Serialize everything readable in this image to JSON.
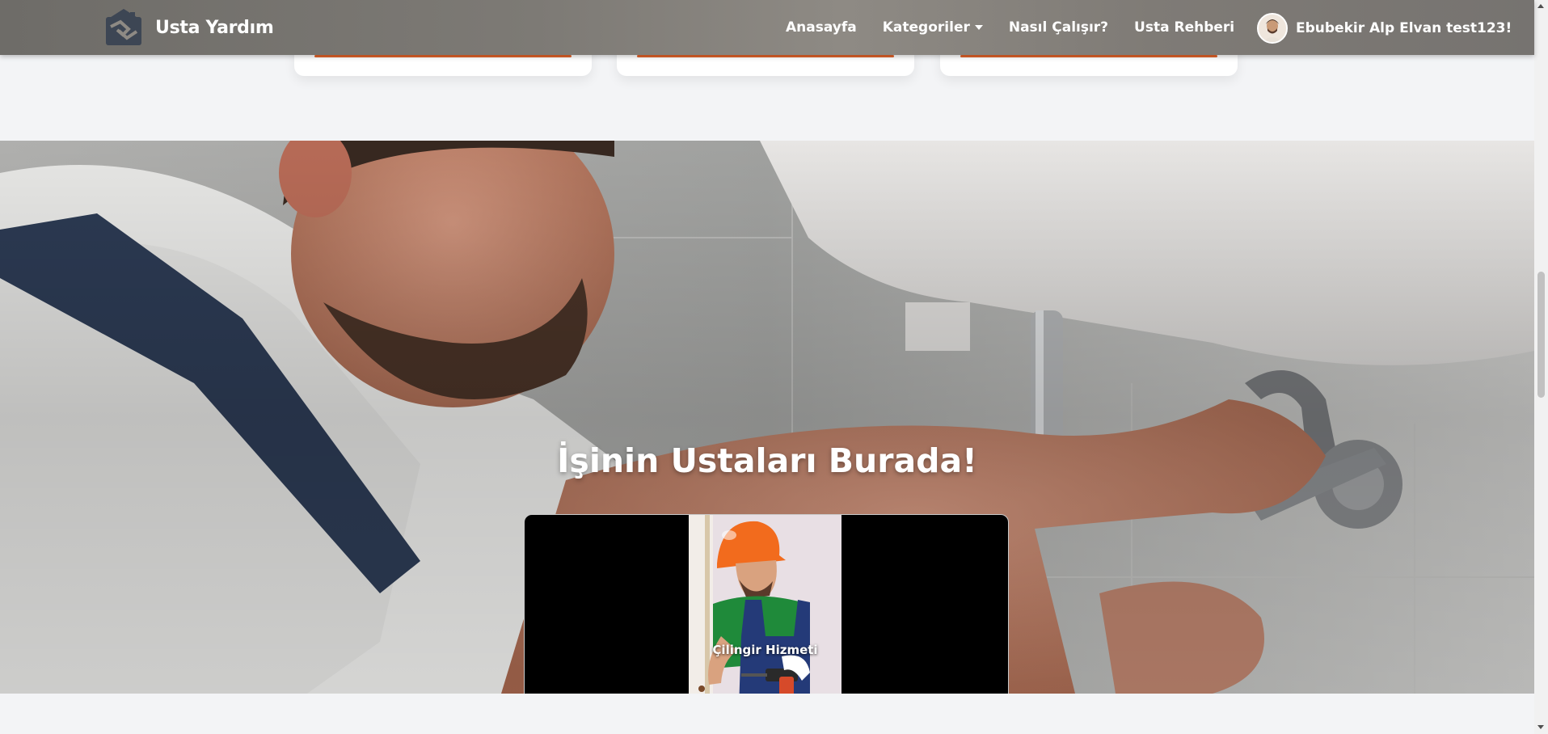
{
  "navbar": {
    "brand_name": "Usta Yardım",
    "links": [
      {
        "label": "Anasayfa"
      },
      {
        "label": "Kategoriler"
      },
      {
        "label": "Nasıl Çalışır?"
      },
      {
        "label": "Usta Rehberi"
      }
    ],
    "user_name": "Ebubekir Alp Elvan test123!"
  },
  "hero": {
    "title": "İşinin Ustaları Burada!",
    "video_caption": "Çilingir Hizmeti"
  },
  "colors": {
    "accent": "#e2632a",
    "page_bg": "#f3f4f6",
    "helmet": "#f26b1d",
    "shirt": "#1f8a3a",
    "overalls": "#243a78"
  },
  "icons": {
    "brand_logo": "house-handshake-logo",
    "dropdown": "caret-down-icon",
    "avatar": "user-avatar"
  }
}
